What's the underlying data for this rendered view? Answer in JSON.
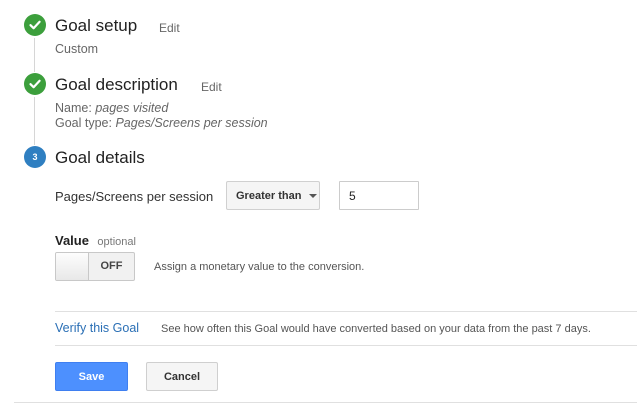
{
  "steps": [
    {
      "title": "Goal setup",
      "edit_label": "Edit",
      "summary": "Custom"
    },
    {
      "title": "Goal description",
      "edit_label": "Edit",
      "name_label": "Name:",
      "name_value": "pages visited",
      "type_label": "Goal type:",
      "type_value": "Pages/Screens per session"
    },
    {
      "number": "3",
      "title": "Goal details"
    }
  ],
  "details": {
    "condition_label": "Pages/Screens per session",
    "comparison_selected": "Greater than",
    "threshold_value": "5",
    "value_label": "Value",
    "value_optional": "optional",
    "toggle_state": "OFF",
    "toggle_hint": "Assign a monetary value to the conversion.",
    "verify_link": "Verify this Goal",
    "verify_hint": "See how often this Goal would have converted based on your data from the past 7 days."
  },
  "actions": {
    "save_label": "Save",
    "cancel_label": "Cancel"
  },
  "colors": {
    "done_step": "#3c9f3c",
    "current_step": "#2f7fc1",
    "link": "#2a6fb5",
    "primary_button": "#4d90fe"
  },
  "icons": {
    "done": "checkmark-icon",
    "dropdown": "caret-down-icon"
  }
}
